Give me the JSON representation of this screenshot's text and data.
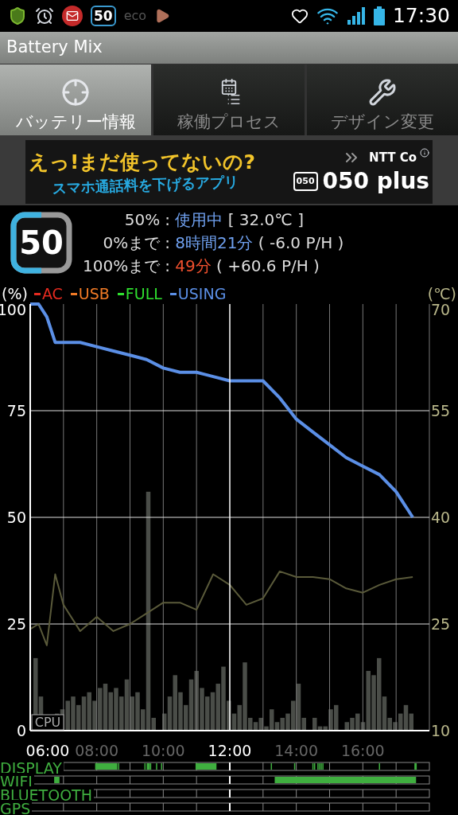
{
  "status_bar": {
    "badge": "50",
    "eco": "eco",
    "time": "17:30"
  },
  "window": {
    "title": "Battery Mix"
  },
  "tabs": [
    {
      "label": "バッテリー情報",
      "kind": "target",
      "selected": true
    },
    {
      "label": "稼働プロセス",
      "kind": "process",
      "selected": false
    },
    {
      "label": "デザイン変更",
      "kind": "wrench",
      "selected": false
    }
  ],
  "ad": {
    "headline": "えっ!まだ使ってないの?",
    "subline": "スマホ通話料を下げるアプリ",
    "sponsor": "NTT Co",
    "app_icon": "050",
    "app_name": "050 plus"
  },
  "battery": {
    "percent": "50",
    "rows": [
      {
        "label": "50%",
        "separator": ":",
        "value": "使用中",
        "color": "#6fa0ef",
        "extra": "[ 32.0℃ ]"
      },
      {
        "label": "0%まで",
        "separator": ":",
        "value": "8時間21分",
        "color": "#6fa0ef",
        "extra": "( -6.0 P/H )"
      },
      {
        "label": "100%まで",
        "separator": ":",
        "value": "49分",
        "color": "#f0502e",
        "extra": "( +60.6 P/H )"
      }
    ]
  },
  "legend": {
    "left_unit": "(%)",
    "right_unit": "(℃)",
    "items": [
      {
        "label": "AC",
        "color": "#e52a1f"
      },
      {
        "label": "USB",
        "color": "#f07a26"
      },
      {
        "label": "FULL",
        "color": "#2fe02f"
      }
    ]
  },
  "cpu": {
    "label": "CPU"
  },
  "chart_data": {
    "type": "line",
    "x": [
      6,
      6.25,
      6.5,
      6.75,
      7,
      7.5,
      8,
      8.5,
      9,
      9.5,
      10,
      10.5,
      11,
      11.5,
      12,
      12.5,
      13,
      13.5,
      14,
      14.5,
      15,
      15.5,
      16,
      16.5,
      17,
      17.5
    ],
    "xlim": [
      6,
      18
    ],
    "grid": true,
    "ref_lines": [
      {
        "axis": "x",
        "value": 12,
        "color": "#ffffff"
      }
    ],
    "ylim": [
      0,
      100
    ],
    "y2lim": [
      10,
      70
    ],
    "xticks": [
      {
        "value": 6,
        "label": "06:00"
      },
      {
        "value": 8,
        "label": "08:00"
      },
      {
        "value": 10,
        "label": "10:00"
      },
      {
        "value": 12,
        "label": "12:00"
      },
      {
        "value": 14,
        "label": "14:00"
      },
      {
        "value": 16,
        "label": "16:00"
      }
    ],
    "yticks": [
      0,
      25,
      50,
      75,
      100
    ],
    "y2ticks": [
      10,
      25,
      40,
      55,
      70
    ],
    "series": [
      {
        "name": "USING",
        "color": "#5b8fe6",
        "values": [
          100,
          100,
          97,
          91,
          91,
          91,
          90,
          89,
          88,
          87,
          85,
          84,
          84,
          83,
          82,
          82,
          82,
          78,
          73,
          70,
          67,
          64,
          62,
          60,
          56,
          50
        ]
      },
      {
        "color": "#5a5a3a",
        "axis": "y2",
        "values": [
          24.3,
          25,
          22,
          32,
          27.7,
          24,
          26,
          24,
          25,
          26.5,
          28,
          28,
          27,
          32,
          30.5,
          27.7,
          28.6,
          32.4,
          31.6,
          31.6,
          31.3,
          30,
          29.4,
          30.5,
          31.3,
          31.6
        ]
      }
    ]
  },
  "activity": [
    {
      "label": "DISPLAY"
    },
    {
      "label": "WIFI"
    },
    {
      "label": "BLUETOOTH"
    },
    {
      "label": "GPS"
    }
  ]
}
